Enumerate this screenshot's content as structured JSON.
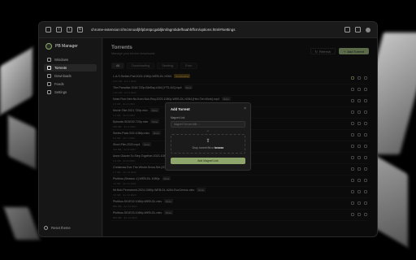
{
  "browser": {
    "url": "chrome-extension://mcmnoafjhfpbmtpcgabljkmfagmbdefhaahhffcm/options.html#/settings"
  },
  "sidebar": {
    "brand": "PB Manager",
    "items": [
      {
        "label": "Windows",
        "active": false
      },
      {
        "label": "Torrents",
        "active": true
      },
      {
        "label": "Downloads",
        "active": false
      },
      {
        "label": "Feeds",
        "active": false
      },
      {
        "label": "Settings",
        "active": false
      }
    ],
    "bottom_label": "Reset theme"
  },
  "page": {
    "title": "Torrents",
    "subtitle": "Manage your torrent downloads",
    "refresh_label": "Refresh",
    "add_label": "Add Torrent",
    "tabs": [
      "All",
      "Downloading",
      "Seeding",
      "Error"
    ]
  },
  "torrents": [
    {
      "name": "L.A.S.Switch.Pair.2024.1080p.WEB-DL.H264",
      "meta": "9.31 GB · Jun 1 2024",
      "badge": "Downloading",
      "badge_type": "warn"
    },
    {
      "name": "The.Paradise.2016.720p.BluRay.x264.[YTS.AG].mp4",
      "meta": "1.01 GB · Jun 3 2024",
      "badge": "Done",
      "badge_type": "normal"
    },
    {
      "name": "Nose.Ron.Hee.No.Kom.Nuk.Roq.2023.1080p.WEB-DL.H264.[Hen.Tim.Work].mp4",
      "meta": "2.3 GB · Jun 4 2024",
      "badge": "Done",
      "badge_type": "normal"
    },
    {
      "name": "Movie.Title.2021.720p.mkv",
      "meta": "1.2 GB · Jun 5 2024",
      "badge": "Done",
      "badge_type": "normal"
    },
    {
      "name": "Episode.S01E02.720p.mkv",
      "meta": "540 MB · Jun 6 2024",
      "badge": "Done",
      "badge_type": "normal"
    },
    {
      "name": "Series.Pack.S02.1080p.mkv",
      "meta": "6.2 GB · Jun 7 2024",
      "badge": "Done",
      "badge_type": "normal"
    },
    {
      "name": "Short.Film.2020.mp4",
      "meta": "310 MB · Jun 8 2024",
      "badge": "Done",
      "badge_type": "normal"
    },
    {
      "name": "Anne.Glacier.To.Step.Together.2023.1080p.WEB-DL.H264-Spyder",
      "meta": "1.9 GB · Jun 9 2024",
      "badge": "Done",
      "badge_type": "normal"
    },
    {
      "name": "Christmas.Eve-The.Whole.Snow.Set.(2024).1080p.WEB-DL.[MKV].SnowShine.mkv",
      "meta": "2.7 GB · Jun 10 2024",
      "badge": "Done",
      "badge_type": "normal"
    },
    {
      "name": "Plutibus.(Season-1).WEB-DL.1080p",
      "meta": "4.4 GB · Jun 11 2024",
      "badge": "Done",
      "badge_type": "normal"
    },
    {
      "name": "Mr.Bob.Permanent.2024.1080p.WEB-DL.h264-EvoGenius.mkv",
      "meta": "3.0 GB · Jun 12 2024",
      "badge": "Done",
      "badge_type": "normal"
    },
    {
      "name": "Plutibus.S01E02.1080p.WEB-DL.mkv",
      "meta": "850 MB · Jun 13 2024",
      "badge": "Done",
      "badge_type": "normal"
    },
    {
      "name": "Plutibus.S01E03.1080p.WEB-DL.mkv",
      "meta": "860 MB · Jun 14 2024",
      "badge": "Done",
      "badge_type": "normal"
    }
  ],
  "modal": {
    "title": "Add Torrent",
    "close_icon": "×",
    "label": "Magnet Link",
    "placeholder": "magnet:?xt=urn:btih:...",
    "or_text": "or",
    "drop_text": "Drop .torrent file or",
    "browse_text": "browse",
    "submit_label": "Add Magnet Link"
  },
  "colors": {
    "accent": "#a6c285",
    "warn": "#e6b94a"
  }
}
